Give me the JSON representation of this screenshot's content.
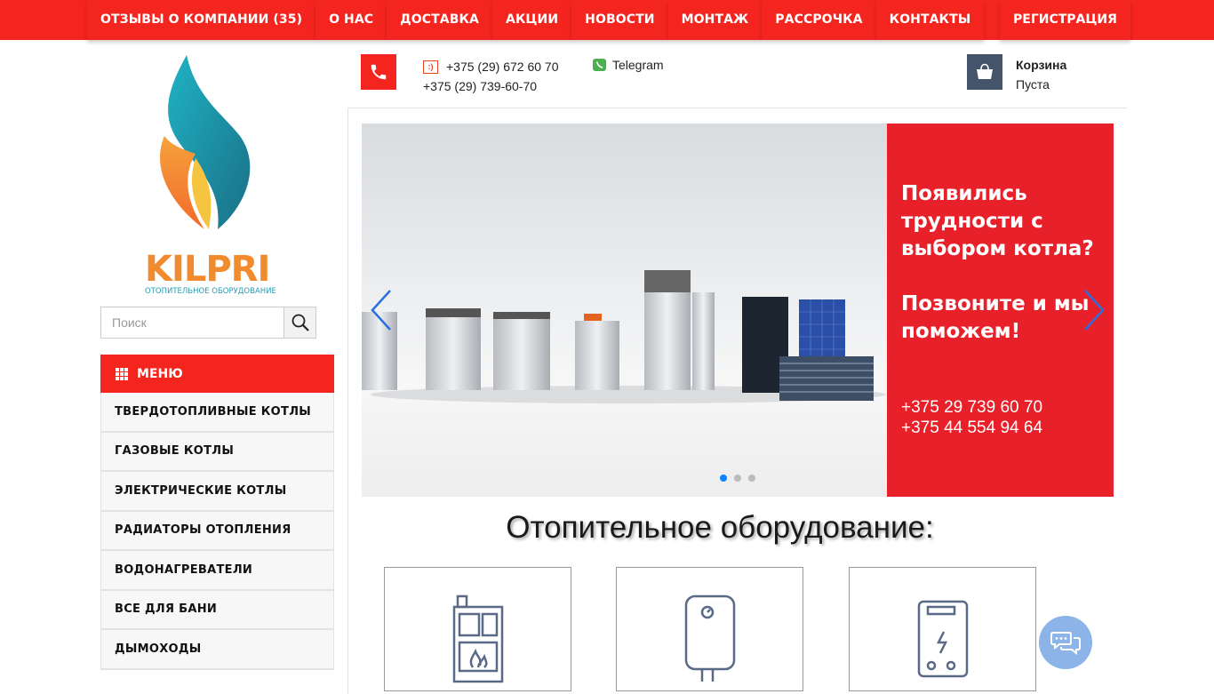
{
  "nav": {
    "items": [
      "ОТЗЫВЫ О КОМПАНИИ (35)",
      "О НАС",
      "ДОСТАВКА",
      "АКЦИИ",
      "НОВОСТИ",
      "МОНТАЖ",
      "РАССРОЧКА",
      "КОНТАКТЫ"
    ],
    "register": "РЕГИСТРАЦИЯ"
  },
  "logo": {
    "brand": "KILPRI",
    "tagline": "ОТОПИТЕЛЬНОЕ ОБОРУДОВАНИЕ"
  },
  "search": {
    "placeholder": "Поиск"
  },
  "menu": {
    "title": "МЕНЮ",
    "items": [
      "ТВЕРДОТОПЛИВНЫЕ КОТЛЫ",
      "ГАЗОВЫЕ КОТЛЫ",
      "ЭЛЕКТРИЧЕСКИЕ КОТЛЫ",
      "РАДИАТОРЫ ОТОПЛЕНИЯ",
      "ВОДОНАГРЕВАТЕЛИ",
      "ВСЕ ДЛЯ БАНИ",
      "ДЫМОХОДЫ"
    ]
  },
  "contacts": {
    "mts_badge": ":)",
    "phone1": "+375 (29) 672 60 70",
    "phone2": "+375 (29) 739-60-70",
    "telegram": "Telegram"
  },
  "cart": {
    "title": "Корзина",
    "status": "Пуста"
  },
  "slider": {
    "headline": "Появились трудности с выбором котла?",
    "cta": "Позвоните и мы поможем!",
    "phone_a": "+375 29 739 60 70",
    "phone_b": "+375 44 554 94 64",
    "active_slide": 1,
    "slide_count": 3
  },
  "section": {
    "title": "Отопительное оборудование:"
  },
  "categories": [
    {
      "icon": "solid-fuel-boiler-icon"
    },
    {
      "icon": "water-heater-icon"
    },
    {
      "icon": "electric-boiler-icon"
    }
  ],
  "colors": {
    "accent": "#f4241f",
    "cart": "#44546a",
    "telegram": "#4caf50",
    "chat": "#8cb4e8"
  }
}
